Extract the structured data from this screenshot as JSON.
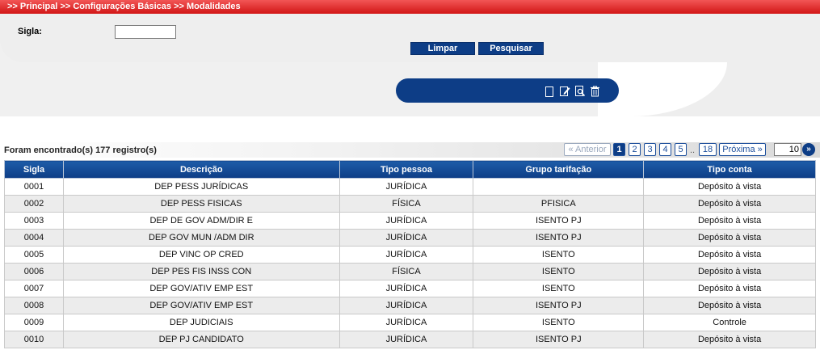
{
  "breadcrumb": {
    "items": [
      ">> Principal",
      ">> Configurações Básicas",
      ">> Modalidades"
    ]
  },
  "filter": {
    "sigla_label": "Sigla:",
    "sigla_value": "",
    "clear_label": "Limpar",
    "search_label": "Pesquisar"
  },
  "toolbar": {
    "icons": [
      "new-icon",
      "edit-icon",
      "view-icon",
      "delete-icon"
    ]
  },
  "results": {
    "count_text": "Foram encontrado(s) 177 registro(s)"
  },
  "pager": {
    "prev_label": "« Anterior",
    "pages": [
      "1",
      "2",
      "3",
      "4",
      "5"
    ],
    "ellipsis": "..",
    "last_page": "18",
    "next_label": "Próxima »",
    "page_size": "10",
    "go_label": "»"
  },
  "table": {
    "columns": [
      "Sigla",
      "Descrição",
      "Tipo pessoa",
      "Grupo tarifação",
      "Tipo conta"
    ],
    "rows": [
      [
        "0001",
        "DEP PESS JURÍDICAS",
        "JURÍDICA",
        "",
        "Depósito à vista"
      ],
      [
        "0002",
        "DEP PESS FISICAS",
        "FÍSICA",
        "PFISICA",
        "Depósito à vista"
      ],
      [
        "0003",
        "DEP DE GOV ADM/DIR E",
        "JURÍDICA",
        "ISENTO PJ",
        "Depósito à vista"
      ],
      [
        "0004",
        "DEP GOV MUN /ADM DIR",
        "JURÍDICA",
        "ISENTO PJ",
        "Depósito à vista"
      ],
      [
        "0005",
        "DEP VINC OP CRED",
        "JURÍDICA",
        "ISENTO",
        "Depósito à vista"
      ],
      [
        "0006",
        "DEP PES FIS INSS CON",
        "FÍSICA",
        "ISENTO",
        "Depósito à vista"
      ],
      [
        "0007",
        "DEP GOV/ATIV EMP EST",
        "JURÍDICA",
        "ISENTO",
        "Depósito à vista"
      ],
      [
        "0008",
        "DEP GOV/ATIV EMP EST",
        "JURÍDICA",
        "ISENTO PJ",
        "Depósito à vista"
      ],
      [
        "0009",
        "DEP JUDICIAIS",
        "JURÍDICA",
        "ISENTO",
        "Controle"
      ],
      [
        "0010",
        "DEP PJ CANDIDATO",
        "JURÍDICA",
        "ISENTO PJ",
        "Depósito à vista"
      ]
    ]
  }
}
